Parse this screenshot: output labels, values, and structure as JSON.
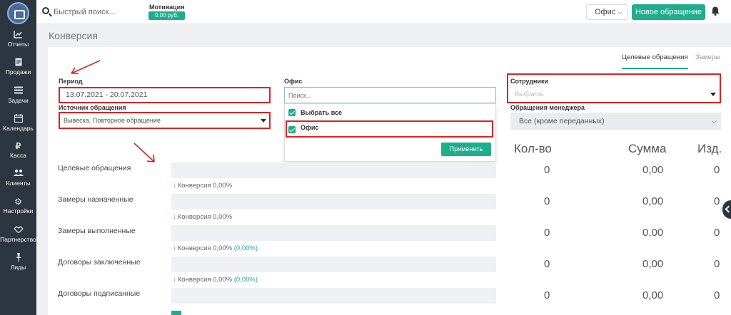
{
  "sidebar": {
    "items": [
      {
        "label": "Отчеты",
        "icon": "chart-line-icon"
      },
      {
        "label": "Продажи",
        "icon": "document-icon"
      },
      {
        "label": "Задачи",
        "icon": "list-icon"
      },
      {
        "label": "Календарь",
        "icon": "calendar-icon"
      },
      {
        "label": "Касса",
        "icon": "ruble-icon"
      },
      {
        "label": "Клиенты",
        "icon": "users-icon"
      },
      {
        "label": "Настройки",
        "icon": "gear-icon"
      },
      {
        "label": "Партнерство",
        "icon": "handshake-icon"
      },
      {
        "label": "Лиды",
        "icon": "pin-icon"
      }
    ]
  },
  "topbar": {
    "search_placeholder": "Быстрый поиск...",
    "motivation_label": "Мотивация",
    "motivation_value": "0.00 руб.",
    "office_value": "Офис",
    "new_request_label": "Новое обращение"
  },
  "page": {
    "title": "Конверсия"
  },
  "tabs": {
    "active": "Целевые обращения",
    "other": "Замеры"
  },
  "filters": {
    "period_label": "Период",
    "period_value": "13.07.2021 - 20.07.2021",
    "source_label": "Источник обращения",
    "source_value": "Вывеска, Повторное обращение",
    "office_label": "Офис",
    "office_search_placeholder": "Поиск...",
    "office_select_all": "Выбрать все",
    "office_option": "Офис",
    "apply_label": "Применить",
    "employees_label": "Сотрудники",
    "employees_placeholder": "Выбрать",
    "manager_label": "Обращения менеджера",
    "manager_value": "Все (кроме переданных)"
  },
  "table": {
    "headers": {
      "count": "Кол-во",
      "sum": "Сумма",
      "items": "Изд."
    },
    "rows": [
      {
        "label": "Целевые обращения",
        "count": "0",
        "sum": "0,00",
        "items": "0"
      },
      {
        "label": "Замеры назначенные",
        "count": "0",
        "sum": "0,00",
        "items": "0"
      },
      {
        "label": "Замеры выполненные",
        "count": "0",
        "sum": "0,00",
        "items": "0"
      },
      {
        "label": "Договоры заключенные",
        "count": "0",
        "sum": "0,00",
        "items": "0"
      },
      {
        "label": "Договоры подписанные",
        "count": "0",
        "sum": "0,00",
        "items": "0"
      }
    ],
    "conversions": [
      {
        "text": "Конверсия 0,00%",
        "extra": ""
      },
      {
        "text": "Конверсия 0,00%",
        "extra": ""
      },
      {
        "text": "Конверсия 0,00%",
        "extra": "(0,00%)"
      },
      {
        "text": "Конверсия 0,00%",
        "extra": "(0,00%)"
      }
    ]
  },
  "colors": {
    "accent": "#1fae8c",
    "sidebar": "#2c3540",
    "highlight": "#dd2222"
  }
}
